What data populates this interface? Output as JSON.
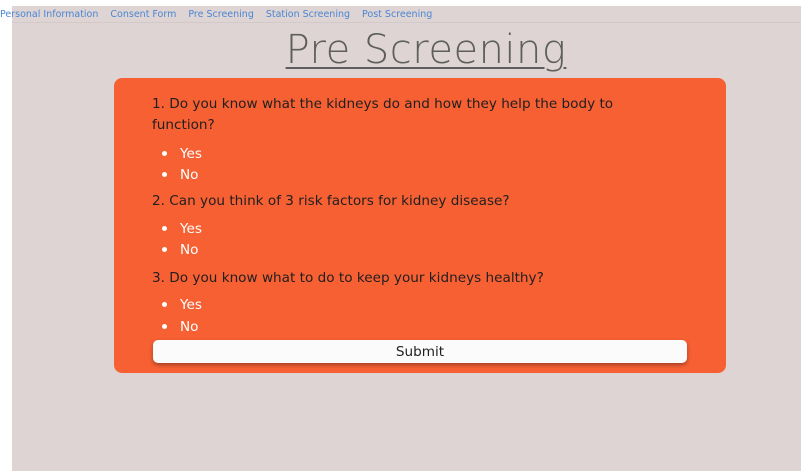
{
  "nav": {
    "items": [
      {
        "label": "Personal Information"
      },
      {
        "label": "Consent Form"
      },
      {
        "label": "Pre Screening"
      },
      {
        "label": "Station Screening"
      },
      {
        "label": "Post Screening"
      }
    ]
  },
  "page": {
    "title": "Pre Screening"
  },
  "form": {
    "questions": [
      {
        "text": "1. Do you know what the kidneys do and how they help the body to function?",
        "options": [
          "Yes",
          "No"
        ]
      },
      {
        "text": "2. Can you think of 3 risk factors for kidney disease?",
        "options": [
          "Yes",
          "No"
        ]
      },
      {
        "text": "3. Do you know what to do to keep your kidneys healthy?",
        "options": [
          "Yes",
          "No"
        ]
      }
    ],
    "submit_label": "Submit"
  },
  "colors": {
    "card": "#f76033",
    "background": "#ded4d3",
    "nav_link": "#4a86d4",
    "title": "#5e5e5e"
  }
}
